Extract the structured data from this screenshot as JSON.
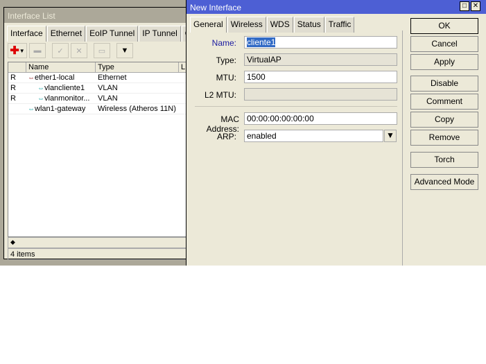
{
  "interface_list": {
    "title": "Interface List",
    "tabs": [
      "Interface",
      "Ethernet",
      "EoIP Tunnel",
      "IP Tunnel",
      "GR"
    ],
    "columns": [
      "",
      "Name",
      "Type",
      "L"
    ],
    "rows": [
      {
        "flag": "R",
        "name": "ether1-local",
        "type": "Ethernet",
        "indent": 0
      },
      {
        "flag": "R",
        "name": "vlancliente1",
        "type": "VLAN",
        "indent": 1
      },
      {
        "flag": "R",
        "name": "vlanmonitor...",
        "type": "VLAN",
        "indent": 1
      },
      {
        "flag": "",
        "name": "wlan1-gateway",
        "type": "Wireless (Atheros 11N)",
        "indent": 0
      }
    ],
    "status": "4 items"
  },
  "dialog": {
    "title": "New Interface",
    "tabs": [
      "General",
      "Wireless",
      "WDS",
      "Status",
      "Traffic"
    ],
    "fields": {
      "name_label": "Name:",
      "name": "cliente1",
      "type_label": "Type:",
      "type": "VirtualAP",
      "mtu_label": "MTU:",
      "mtu": "1500",
      "l2mtu_label": "L2 MTU:",
      "l2mtu": "",
      "mac_label": "MAC Address:",
      "mac": "00:00:00:00:00:00",
      "arp_label": "ARP:",
      "arp": "enabled"
    },
    "buttons": [
      "OK",
      "Cancel",
      "Apply",
      "Disable",
      "Comment",
      "Copy",
      "Remove",
      "Torch",
      "Advanced Mode"
    ]
  },
  "colors": {
    "title_active": "#4d5fd4",
    "title_inactive": "#aca899",
    "window_bg": "#ece9d8",
    "name_label": "#1a1aa0",
    "selection": "#316ac5"
  }
}
